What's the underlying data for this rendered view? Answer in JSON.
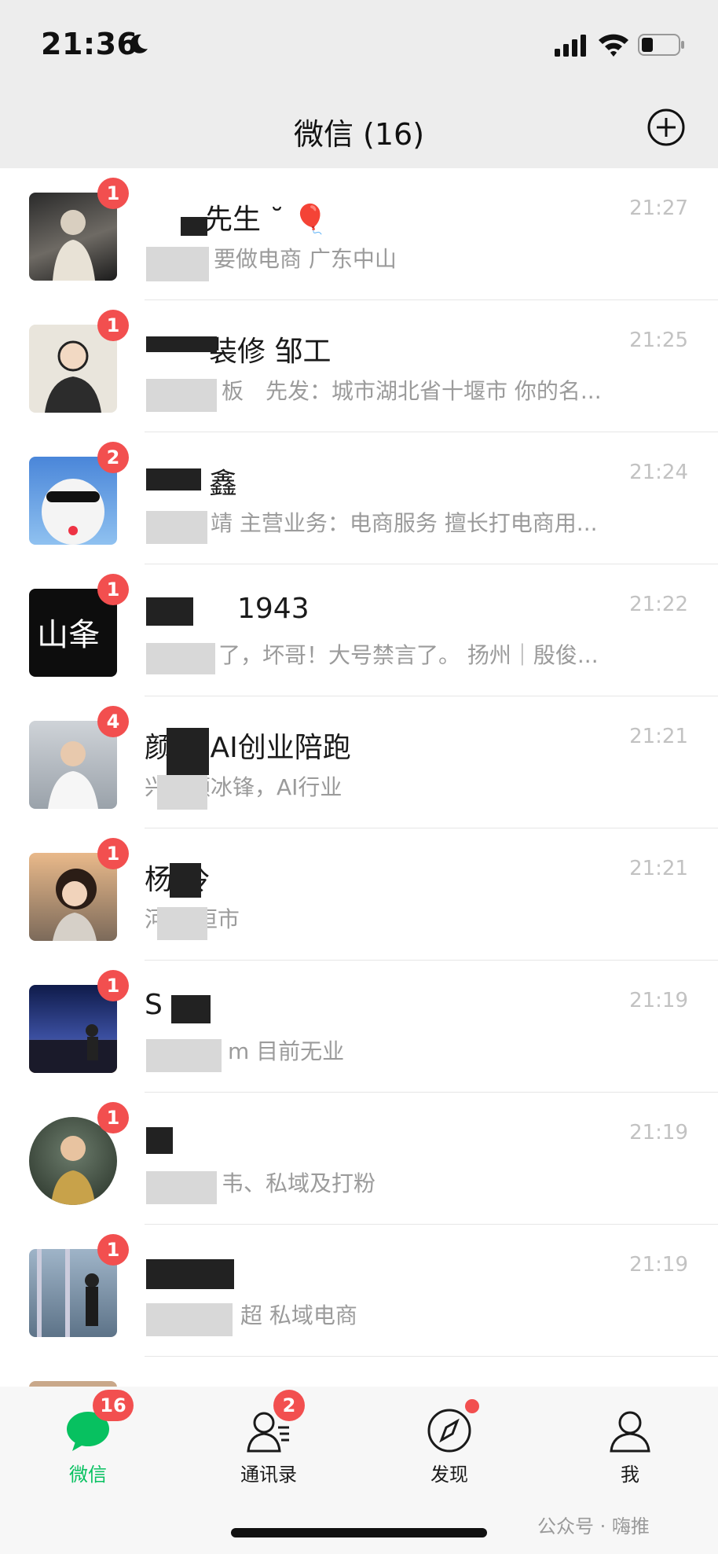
{
  "status_bar": {
    "time": "21:36"
  },
  "nav": {
    "title": "微信 (16)"
  },
  "chats": [
    {
      "name": "先生 ˘ 🎈",
      "preview": "要做电商 广东中山",
      "time": "21:27",
      "badge": "1"
    },
    {
      "name": "装修 邹工",
      "preview": "板　先发：城市湖北省十堰市 你的名...",
      "time": "21:25",
      "badge": "1"
    },
    {
      "name": "鑫",
      "preview": "靖 主营业务：电商服务 擅长打电商用...",
      "time": "21:24",
      "badge": "2"
    },
    {
      "name": "1943",
      "preview": "了，坏哥！大号禁言了。 扬州｜殷俊...",
      "time": "21:22",
      "badge": "1"
    },
    {
      "name": "颜 师AI创业陪跑",
      "preview": "兴，颜冰锋，AI行业",
      "time": "21:21",
      "badge": "4"
    },
    {
      "name": "杨 冷",
      "preview": "河 长垣市",
      "time": "21:21",
      "badge": "1"
    },
    {
      "name": "S",
      "preview": "m 目前无业",
      "time": "21:19",
      "badge": "1"
    },
    {
      "name": "",
      "preview": "韦、私域及打粉",
      "time": "21:19",
      "badge": "1"
    },
    {
      "name": "",
      "preview": "超 私域电商",
      "time": "21:19",
      "badge": "1"
    }
  ],
  "tabs": [
    {
      "label": "微信",
      "badge": "16",
      "icon": "chat-bubble-icon"
    },
    {
      "label": "通讯录",
      "badge": "2",
      "icon": "contacts-icon"
    },
    {
      "label": "发现",
      "badge": "",
      "icon": "compass-icon"
    },
    {
      "label": "我",
      "badge": "",
      "icon": "person-icon"
    }
  ],
  "watermark": "公众号 · 嗨推",
  "colors": {
    "accent": "#07c160",
    "badge": "#f24f4f",
    "background": "#ededed"
  }
}
